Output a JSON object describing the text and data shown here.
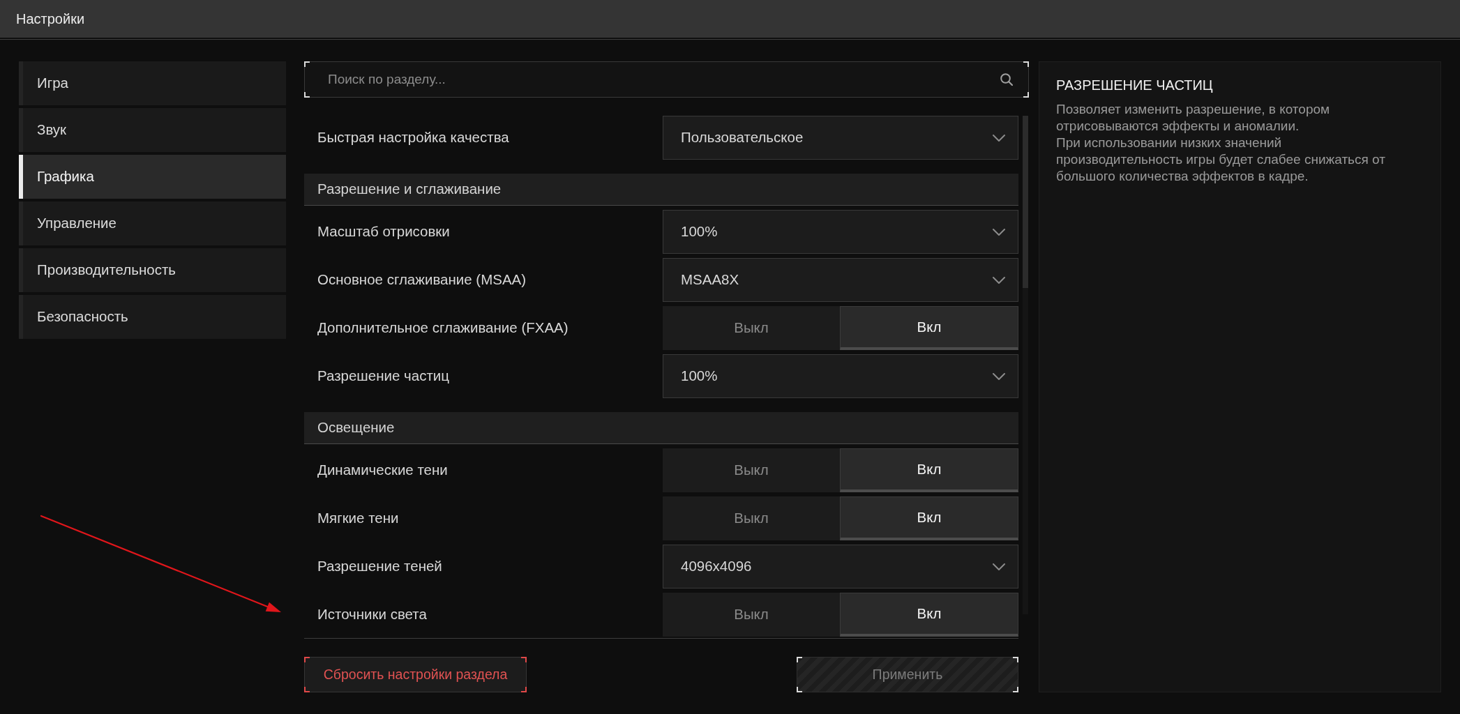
{
  "window": {
    "title": "Настройки"
  },
  "sidebar": {
    "items": [
      {
        "label": "Игра",
        "selected": false
      },
      {
        "label": "Звук",
        "selected": false
      },
      {
        "label": "Графика",
        "selected": true
      },
      {
        "label": "Управление",
        "selected": false
      },
      {
        "label": "Производительность",
        "selected": false
      },
      {
        "label": "Безопасность",
        "selected": false
      }
    ]
  },
  "search": {
    "placeholder": "Поиск по разделу..."
  },
  "settings": [
    {
      "kind": "dropdown",
      "label": "Быстрая настройка качества",
      "value": "Пользовательское"
    },
    {
      "kind": "section",
      "label": "Разрешение и сглаживание"
    },
    {
      "kind": "dropdown",
      "label": "Масштаб отрисовки",
      "value": "100%"
    },
    {
      "kind": "dropdown",
      "label": "Основное сглаживание (MSAA)",
      "value": "MSAA8X"
    },
    {
      "kind": "toggle",
      "label": "Дополнительное сглаживание (FXAA)",
      "options": [
        {
          "label": "Выкл",
          "selected": false
        },
        {
          "label": "Вкл",
          "selected": true
        }
      ]
    },
    {
      "kind": "dropdown",
      "label": "Разрешение частиц",
      "value": "100%"
    },
    {
      "kind": "section",
      "label": "Освещение"
    },
    {
      "kind": "toggle",
      "label": "Динамические тени",
      "options": [
        {
          "label": "Выкл",
          "selected": false
        },
        {
          "label": "Вкл",
          "selected": true
        }
      ]
    },
    {
      "kind": "toggle",
      "label": "Мягкие тени",
      "options": [
        {
          "label": "Выкл",
          "selected": false
        },
        {
          "label": "Вкл",
          "selected": true
        }
      ]
    },
    {
      "kind": "dropdown",
      "label": "Разрешение теней",
      "value": "4096x4096"
    },
    {
      "kind": "toggle",
      "label": "Источники света",
      "options": [
        {
          "label": "Выкл",
          "selected": false
        },
        {
          "label": "Вкл",
          "selected": true
        }
      ]
    }
  ],
  "actions": {
    "reset": {
      "label": "Сбросить настройки раздела"
    },
    "apply": {
      "label": "Применить",
      "disabled": true
    }
  },
  "info_panel": {
    "title": "РАЗРЕШЕНИЕ ЧАСТИЦ",
    "paragraphs": [
      "Позволяет изменить разрешение, в котором отрисовываются эффекты и аномалии.",
      "При использовании низких значений производительность игры будет слабее снижаться от большого количества эффектов в кадре."
    ]
  }
}
